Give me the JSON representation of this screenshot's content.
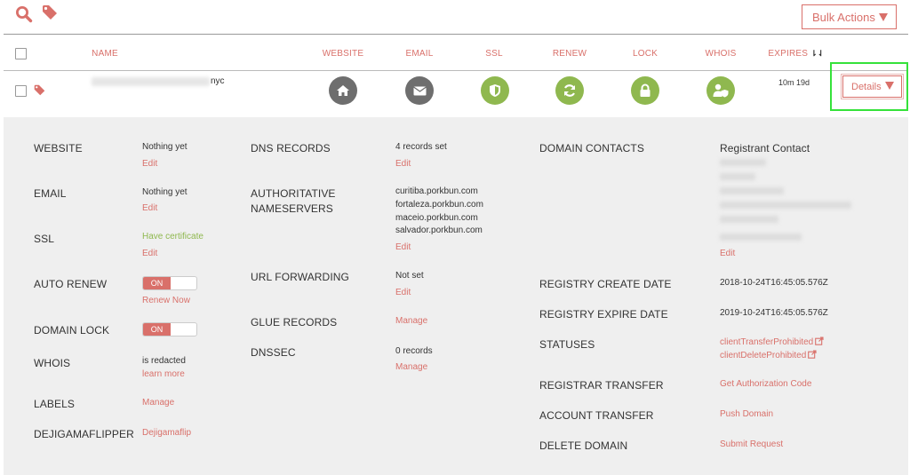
{
  "toolbar": {
    "bulk_actions_label": "Bulk Actions"
  },
  "columns": {
    "name": "NAME",
    "website": "WEBSITE",
    "email": "EMAIL",
    "ssl": "SSL",
    "renew": "RENEW",
    "lock": "LOCK",
    "whois": "WHOIS",
    "expires": "EXPIRES",
    "expires_sort": "⇂⇃"
  },
  "domain_row": {
    "domain_suffix": "nyc",
    "expires": "10m 19d",
    "details_label": "Details",
    "icons": [
      "home-icon",
      "envelope-icon",
      "shield-icon",
      "refresh-icon",
      "lock-icon",
      "user-shield-icon"
    ]
  },
  "details": {
    "website": {
      "label": "WEBSITE",
      "value": "Nothing yet",
      "action": "Edit"
    },
    "email": {
      "label": "EMAIL",
      "value": "Nothing yet",
      "action": "Edit"
    },
    "ssl": {
      "label": "SSL",
      "value": "Have certificate",
      "action": "Edit"
    },
    "auto_renew": {
      "label": "AUTO RENEW",
      "toggle": "ON",
      "action": "Renew Now"
    },
    "domain_lock": {
      "label": "DOMAIN LOCK",
      "toggle": "ON"
    },
    "whois": {
      "label": "WHOIS",
      "value": "is redacted",
      "action": "learn more"
    },
    "labels": {
      "label": "LABELS",
      "action": "Manage"
    },
    "dejigamaflipper": {
      "label": "DEJIGAMAFLIPPER",
      "action": "Dejigamaflip"
    },
    "dns_records": {
      "label": "DNS RECORDS",
      "value": "4 records set",
      "action": "Edit"
    },
    "nameservers": {
      "label_line1": "AUTHORITATIVE",
      "label_line2": "NAMESERVERS",
      "values": [
        "curitiba.porkbun.com",
        "fortaleza.porkbun.com",
        "maceio.porkbun.com",
        "salvador.porkbun.com"
      ],
      "action": "Edit"
    },
    "url_forwarding": {
      "label": "URL FORWARDING",
      "value": "Not set",
      "action": "Edit"
    },
    "glue_records": {
      "label": "GLUE RECORDS",
      "action": "Manage"
    },
    "dnssec": {
      "label": "DNSSEC",
      "value": "0 records",
      "action": "Manage"
    },
    "domain_contacts": {
      "label": "DOMAIN CONTACTS",
      "title": "Registrant Contact",
      "action": "Edit"
    },
    "registry_create": {
      "label": "REGISTRY CREATE DATE",
      "value": "2018-10-24T16:45:05.576Z"
    },
    "registry_expire": {
      "label": "REGISTRY EXPIRE DATE",
      "value": "2019-10-24T16:45:05.576Z"
    },
    "statuses": {
      "label": "STATUSES",
      "values": [
        "clientTransferProhibited",
        "clientDeleteProhibited"
      ]
    },
    "registrar_transfer": {
      "label": "REGISTRAR TRANSFER",
      "action": "Get Authorization Code"
    },
    "account_transfer": {
      "label": "ACCOUNT TRANSFER",
      "action": "Push Domain"
    },
    "delete_domain": {
      "label": "DELETE DOMAIN",
      "action": "Submit Request"
    }
  },
  "colors": {
    "accent": "#d9706a",
    "green": "#8fb84f",
    "gray_icon": "#6e6e6e",
    "highlight": "#35e23a",
    "panel": "#efefef"
  }
}
